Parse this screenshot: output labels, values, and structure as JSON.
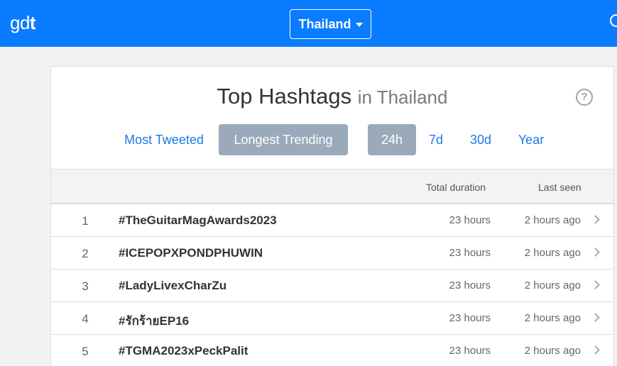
{
  "header": {
    "logo_prefix": "gd",
    "logo_suffix": "t",
    "country_label": "Thailand"
  },
  "card": {
    "title": "Top Hashtags",
    "subtitle": "in Thailand",
    "help_label": "?",
    "tabs": [
      "Most Tweeted",
      "Longest Trending"
    ],
    "active_tab": "Longest Trending",
    "periods": [
      "24h",
      "7d",
      "30d",
      "Year"
    ],
    "active_period": "24h"
  },
  "table": {
    "columns": [
      "Total duration",
      "Last seen"
    ],
    "rows": [
      {
        "rank": "1",
        "hashtag": "#TheGuitarMagAwards2023",
        "duration": "23 hours",
        "last_seen": "2 hours ago"
      },
      {
        "rank": "2",
        "hashtag": "#ICEPOPXPONDPHUWIN",
        "duration": "23 hours",
        "last_seen": "2 hours ago"
      },
      {
        "rank": "3",
        "hashtag": "#LadyLivexCharZu",
        "duration": "23 hours",
        "last_seen": "2 hours ago"
      },
      {
        "rank": "4",
        "hashtag": "#รักร้ายEP16",
        "duration": "23 hours",
        "last_seen": "2 hours ago"
      },
      {
        "rank": "5",
        "hashtag": "#TGMA2023xPeckPalit",
        "duration": "23 hours",
        "last_seen": "2 hours ago"
      }
    ]
  },
  "colors": {
    "topbar": "#0a7cff",
    "link": "#1a79e6",
    "active_tab": "#9aaabb"
  },
  "icons": [
    "caret-down-icon",
    "search-icon",
    "help-icon",
    "chevron-right-icon"
  ]
}
